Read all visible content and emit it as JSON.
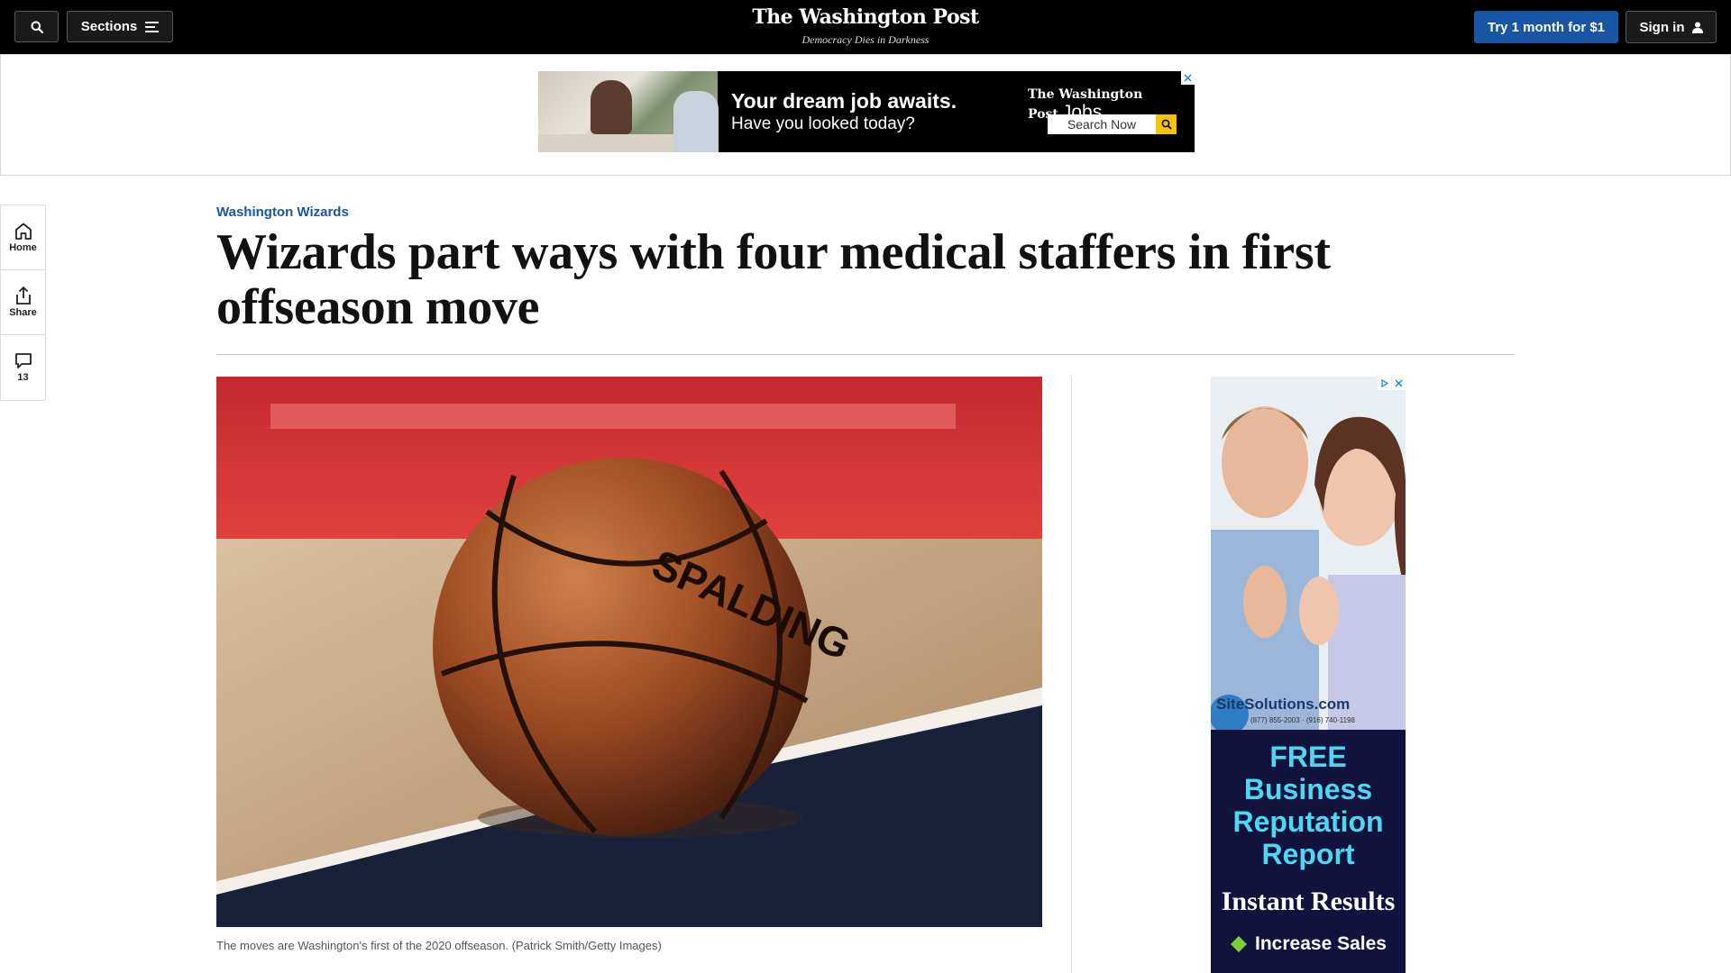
{
  "header": {
    "sections_label": "Sections",
    "logo": "The Washington Post",
    "tagline": "Democracy Dies in Darkness",
    "try_label": "Try 1 month for $1",
    "signin_label": "Sign in",
    "colors": {
      "background": "#000000",
      "accent": "#1955a5"
    }
  },
  "top_ad": {
    "headline": "Your dream job awaits.",
    "subline": "Have you looked today?",
    "brand": "The Washington Post",
    "brand_suffix": "Jobs",
    "search_label": "Search Now"
  },
  "left_rail": {
    "home_label": "Home",
    "share_label": "Share",
    "comment_count": "13"
  },
  "article": {
    "kicker": "Washington Wizards",
    "title": "Wizards part ways with four medical staffers in first offseason move",
    "caption": "The moves are Washington's first of the 2020 offseason. (Patrick Smith/Getty Images)",
    "ball_brand": "SPALDING"
  },
  "side_ad": {
    "logo_text": "SiteSolutions.com",
    "phones": "(877) 855-2003 · (916) 740-1198",
    "offer": "FREE Business Reputation Report",
    "offer_lines": [
      "FREE",
      "Business",
      "Reputation",
      "Report"
    ],
    "instant": "Instant Results",
    "increase": "Increase Sales",
    "accent_color": "#4fd6f1"
  }
}
